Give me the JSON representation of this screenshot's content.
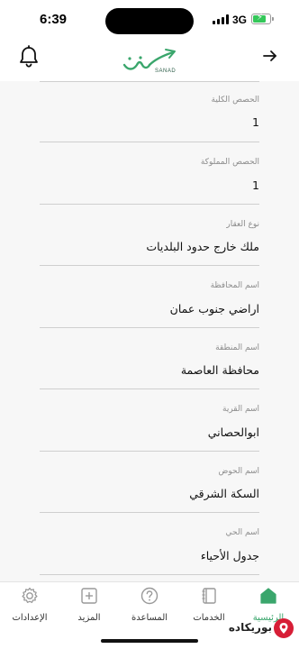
{
  "status_bar": {
    "time": "6:39",
    "network": "3G",
    "battery_level": 0.7,
    "battery_charging": true
  },
  "header": {
    "logo_caption": "SANAD",
    "brand_color": "#3aa66c",
    "icons": {
      "left": "bell-icon",
      "right": "arrow-right-icon"
    }
  },
  "fields": [
    {
      "label": "الحصص الكلية",
      "value": "1"
    },
    {
      "label": "الحصص المملوكة",
      "value": "1"
    },
    {
      "label": "نوع العقار",
      "value": "ملك خارج حدود البلديات"
    },
    {
      "label": "اسم المحافظة",
      "value": "اراضي جنوب عمان"
    },
    {
      "label": "اسم المنطقة",
      "value": "محافظة العاصمة"
    },
    {
      "label": "اسم القرية",
      "value": "ابوالحصاني"
    },
    {
      "label": "اسم الحوض",
      "value": "السكة الشرقي"
    },
    {
      "label": "اسم الحي",
      "value": "جدول الأحياء"
    }
  ],
  "tab_bar": {
    "tabs": [
      {
        "label": "الإعدادات",
        "icon": "gear-icon",
        "active": false
      },
      {
        "label": "المزيد",
        "icon": "plus-square-icon",
        "active": false
      },
      {
        "label": "المساعدة",
        "icon": "question-circle-icon",
        "active": false
      },
      {
        "label": "الخدمات",
        "icon": "book-icon",
        "active": false
      },
      {
        "label": "الرئيسية",
        "icon": "home-icon",
        "active": true
      }
    ]
  },
  "watermark": {
    "text": "بوريكاده"
  }
}
